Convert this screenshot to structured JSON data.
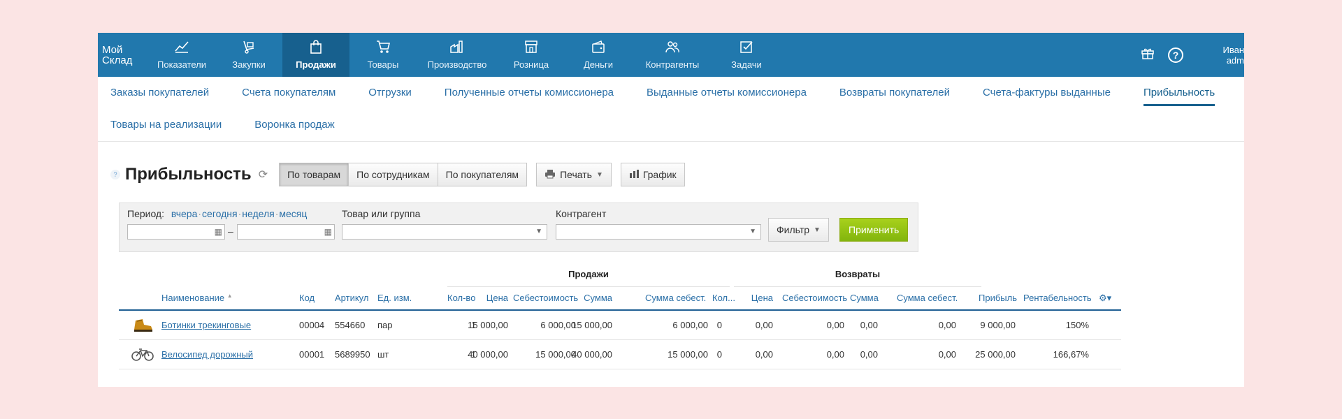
{
  "logo": {
    "line1": "Мой",
    "line2": "Склад"
  },
  "nav": [
    {
      "label": "Показатели",
      "icon": "chart-line-icon",
      "glyph": "📈"
    },
    {
      "label": "Закупки",
      "icon": "hand-cart-icon",
      "glyph": "🛒"
    },
    {
      "label": "Продажи",
      "icon": "shopping-bag-icon",
      "glyph": "🛍"
    },
    {
      "label": "Товары",
      "icon": "cart-icon",
      "glyph": "🛒"
    },
    {
      "label": "Производство",
      "icon": "factory-icon",
      "glyph": "🏭"
    },
    {
      "label": "Розница",
      "icon": "store-icon",
      "glyph": "🏪"
    },
    {
      "label": "Деньги",
      "icon": "wallet-icon",
      "glyph": "👛"
    },
    {
      "label": "Контрагенты",
      "icon": "users-icon",
      "glyph": "👥"
    },
    {
      "label": "Задачи",
      "icon": "checkbox-icon",
      "glyph": "☑"
    }
  ],
  "user": {
    "name": "Иван",
    "role": "adm"
  },
  "subnav": [
    "Заказы покупателей",
    "Счета покупателям",
    "Отгрузки",
    "Полученные отчеты комиссионера",
    "Выданные отчеты комиссионера",
    "Возвраты покупателей",
    "Счета-фактуры выданные",
    "Прибыльность",
    "Товары на реализации",
    "Воронка продаж"
  ],
  "page": {
    "title": "Прибыльность",
    "help": "?"
  },
  "view_tabs": [
    "По товарам",
    "По сотрудникам",
    "По покупателям"
  ],
  "toolbar": {
    "print": "Печать",
    "chart": "График"
  },
  "filter": {
    "period_label": "Период:",
    "yesterday": "вчера",
    "today": "сегодня",
    "week": "неделя",
    "month": "месяц",
    "dash": "–",
    "goods_label": "Товар или группа",
    "counterparty_label": "Контрагент",
    "filter_btn": "Фильтр",
    "apply_btn": "Применить"
  },
  "table": {
    "groups": {
      "sales": "Продажи",
      "returns": "Возвраты"
    },
    "headers": {
      "name": "Наименование",
      "code": "Код",
      "article": "Артикул",
      "unit": "Ед. изм.",
      "s_qty": "Кол-во",
      "s_price": "Цена",
      "s_cost": "Себестоимость",
      "s_sum": "Сумма",
      "s_costsum": "Сумма себест.",
      "r_qty": "Кол...",
      "r_price": "Цена",
      "r_cost": "Себестоимость",
      "r_sum": "Сумма",
      "r_costsum": "Сумма себест.",
      "profit": "Прибыль",
      "margin": "Рентабельность"
    },
    "rows": [
      {
        "thumb": "boot",
        "name": "Ботинки трекинговые",
        "code": "00004",
        "article": "554660",
        "unit": "пар",
        "s_qty": "1",
        "s_price": "15 000,00",
        "s_cost": "6 000,00",
        "s_sum": "15 000,00",
        "s_costsum": "6 000,00",
        "r_qty": "0",
        "r_price": "0,00",
        "r_cost": "0,00",
        "r_sum": "0,00",
        "r_costsum": "0,00",
        "profit": "9 000,00",
        "margin": "150%"
      },
      {
        "thumb": "bicycle",
        "name": "Велосипед дорожный",
        "code": "00001",
        "article": "5689950",
        "unit": "шт",
        "s_qty": "1",
        "s_price": "40 000,00",
        "s_cost": "15 000,00",
        "s_sum": "40 000,00",
        "s_costsum": "15 000,00",
        "r_qty": "0",
        "r_price": "0,00",
        "r_cost": "0,00",
        "r_sum": "0,00",
        "r_costsum": "0,00",
        "profit": "25 000,00",
        "margin": "166,67%"
      }
    ]
  },
  "colors": {
    "topbar": "#2178ad",
    "topbar_active": "#17608e",
    "link": "#2a6fa7",
    "apply": "#94c416",
    "background": "#fbe4e4"
  }
}
